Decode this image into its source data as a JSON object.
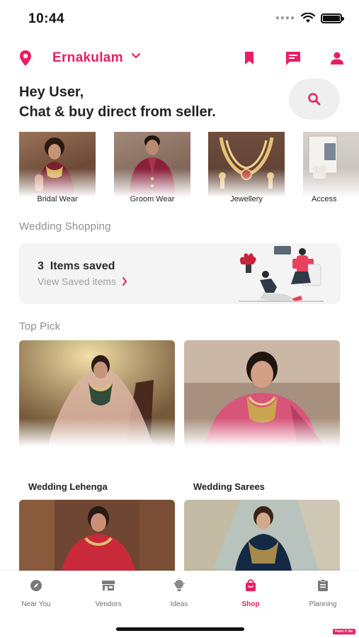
{
  "status_bar": {
    "time": "10:44"
  },
  "header": {
    "location": "Ernakulam"
  },
  "greeting": {
    "line1": "Hey User,",
    "line2": "Chat & buy direct from seller."
  },
  "categories": [
    {
      "label": "Bridal Wear"
    },
    {
      "label": "Groom Wear"
    },
    {
      "label": "Jewellery"
    },
    {
      "label": "Access"
    }
  ],
  "wedding_shopping": {
    "title": "Wedding Shopping",
    "saved_count": "3",
    "saved_text": "Items saved",
    "view_link": "View Saved items"
  },
  "top_pick": {
    "title": "Top Pick",
    "items": [
      {
        "label": "Wedding Lehenga"
      },
      {
        "label": "Wedding Sarees"
      }
    ]
  },
  "bottom_nav": [
    {
      "label": "Near You",
      "icon": "compass-icon"
    },
    {
      "label": "Vendors",
      "icon": "store-icon"
    },
    {
      "label": "Ideas",
      "icon": "bulb-icon"
    },
    {
      "label": "Shop",
      "icon": "shopping-bag-icon",
      "active": true
    },
    {
      "label": "Planning",
      "icon": "clipboard-icon"
    }
  ],
  "watermark": "Paint X lite",
  "colors": {
    "accent": "#e91e63",
    "muted": "#8e8e8e",
    "card_bg": "#f4f4f4"
  }
}
